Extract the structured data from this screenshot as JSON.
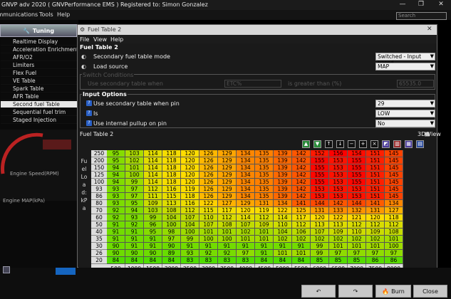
{
  "app": {
    "title": "GNVP adv 2020 ( GNVPerformance EMS ) Registered to: Simon Gonzalez",
    "search_placeholder": "Search"
  },
  "menubar": {
    "items": [
      "Communications",
      "Tools",
      "Help"
    ]
  },
  "left_panel": {
    "tuning_label": "Tuning",
    "items": [
      {
        "label": "Realtime Display"
      },
      {
        "label": "Acceleration Enrichment"
      },
      {
        "label": "AFR/O2"
      },
      {
        "label": "Limiters"
      },
      {
        "label": "Flex Fuel"
      },
      {
        "label": "VE Table"
      },
      {
        "label": "Spark Table"
      },
      {
        "label": "AFR Table"
      },
      {
        "label": "Second fuel Table"
      },
      {
        "label": "Sequential fuel trim"
      },
      {
        "label": "Staged Injection"
      }
    ],
    "selected_index": 8,
    "gauge_label": "Engine Speed(RPM)",
    "map_label": "Engine MAP(kPa)"
  },
  "dialog": {
    "title": "Fuel Table 2",
    "menu": [
      "File",
      "View",
      "Help"
    ],
    "section_title": "Fuel Table 2",
    "mode_label": "Secondary fuel table mode",
    "mode_value": "Switched - Input based",
    "load_label": "Load source",
    "load_value": "MAP",
    "switch_conditions_title": "Switch Conditions",
    "switch_use_label": "Use secondary table when",
    "switch_field_value": "ETC%",
    "switch_greater_label": "is greater than (%)",
    "switch_greater_value": "65535.0",
    "input_options_title": "Input Options",
    "pin_label": "Use secondary table when pin",
    "pin_value": "29",
    "is_label": "Is",
    "is_value": "LOW",
    "pullup_label": "Use internal pullup on pin",
    "pullup_value": "No",
    "table_title": "Fuel Table 2",
    "view3d_label": "3D View",
    "y_axis_label": "Fuel Load: kPa",
    "x_axis_label": "RPM",
    "rpm": [
      500,
      1000,
      1500,
      2000,
      2500,
      3000,
      3500,
      4000,
      4500,
      5000,
      5500,
      6000,
      6500,
      7000,
      7500,
      8000
    ],
    "load": [
      250,
      200,
      150,
      125,
      100,
      93,
      86,
      80,
      70,
      60,
      50,
      40,
      35,
      30,
      26,
      20
    ],
    "table": [
      [
        95,
        103,
        114,
        118,
        120,
        126,
        129,
        134,
        135,
        139,
        142,
        152,
        156,
        154,
        151,
        145
      ],
      [
        95,
        102,
        114,
        118,
        120,
        126,
        129,
        134,
        135,
        139,
        142,
        155,
        153,
        155,
        151,
        145
      ],
      [
        94,
        101,
        114,
        118,
        120,
        126,
        129,
        134,
        135,
        139,
        142,
        155,
        153,
        155,
        151,
        145
      ],
      [
        94,
        100,
        114,
        118,
        120,
        126,
        129,
        134,
        135,
        139,
        142,
        155,
        153,
        155,
        151,
        145
      ],
      [
        94,
        99,
        114,
        118,
        120,
        126,
        129,
        134,
        135,
        139,
        142,
        155,
        153,
        155,
        151,
        145
      ],
      [
        93,
        97,
        112,
        116,
        119,
        126,
        129,
        134,
        135,
        139,
        142,
        153,
        153,
        153,
        151,
        145
      ],
      [
        93,
        97,
        111,
        115,
        118,
        126,
        129,
        134,
        135,
        139,
        142,
        153,
        153,
        153,
        151,
        145
      ],
      [
        93,
        95,
        109,
        113,
        116,
        122,
        127,
        129,
        131,
        134,
        141,
        144,
        142,
        144,
        141,
        134
      ],
      [
        92,
        94,
        103,
        108,
        112,
        115,
        117,
        120,
        119,
        122,
        125,
        131,
        133,
        132,
        131,
        127
      ],
      [
        92,
        93,
        99,
        104,
        107,
        110,
        112,
        114,
        112,
        114,
        117,
        120,
        122,
        121,
        120,
        118
      ],
      [
        91,
        92,
        96,
        100,
        104,
        107,
        108,
        107,
        109,
        110,
        112,
        113,
        113,
        112,
        112,
        112
      ],
      [
        91,
        91,
        95,
        98,
        100,
        101,
        101,
        102,
        101,
        104,
        106,
        107,
        109,
        110,
        109,
        108
      ],
      [
        91,
        91,
        91,
        97,
        99,
        100,
        100,
        101,
        101,
        102,
        102,
        102,
        102,
        102,
        102,
        101
      ],
      [
        90,
        91,
        91,
        90,
        91,
        91,
        91,
        91,
        91,
        91,
        91,
        99,
        101,
        101,
        101,
        100
      ],
      [
        90,
        90,
        90,
        89,
        93,
        92,
        92,
        97,
        91,
        101,
        101,
        99,
        97,
        97,
        97,
        97
      ],
      [
        84,
        84,
        84,
        84,
        83,
        83,
        83,
        83,
        84,
        84,
        84,
        85,
        85,
        85,
        86,
        86
      ]
    ]
  },
  "bottom": {
    "burn_label": "Burn",
    "close_label": "Close"
  }
}
